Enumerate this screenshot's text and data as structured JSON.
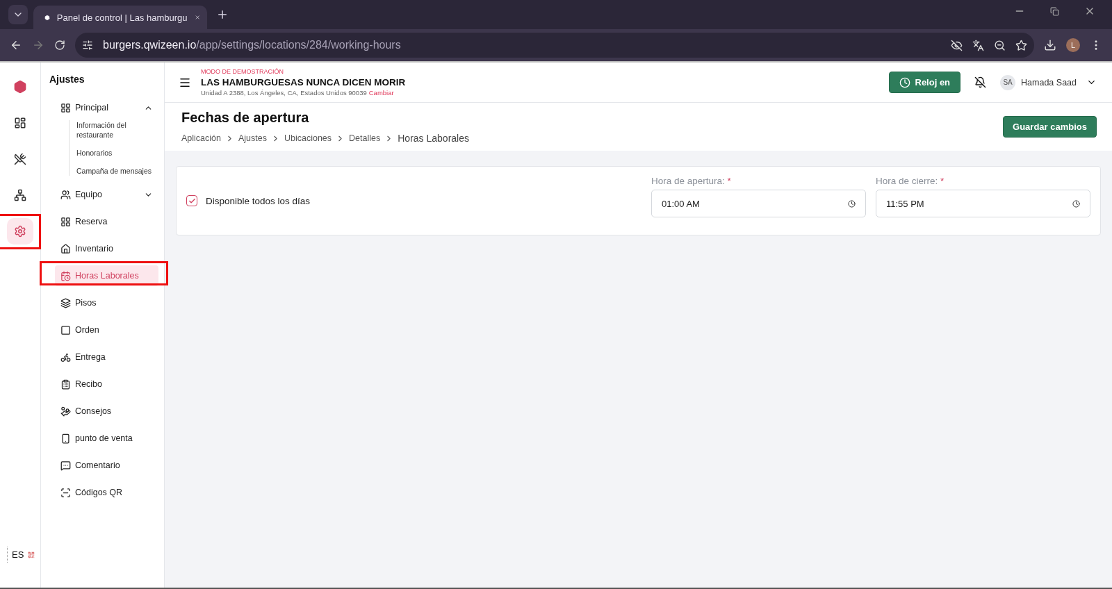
{
  "browser": {
    "tab_title": "Panel de control | Las hamburgu",
    "url_host": "burgers.qwizeen.io",
    "url_path": "/app/settings/locations/284/working-hours",
    "profile_initial": "L"
  },
  "rail": {
    "items": [
      {
        "selected": false
      },
      {
        "selected": false
      },
      {
        "selected": false
      },
      {
        "selected": true,
        "annotated": true
      }
    ]
  },
  "sidebar": {
    "title": "Ajustes",
    "items": [
      {
        "label": "Principal",
        "kind": "group",
        "expanded": true,
        "selected": false,
        "children": [
          {
            "label": "Información del restaurante"
          },
          {
            "label": "Honorarios"
          },
          {
            "label": "Campaña de mensajes"
          }
        ]
      },
      {
        "label": "Equipo",
        "kind": "group",
        "expanded": false,
        "selected": false
      },
      {
        "label": "Reserva",
        "kind": "link",
        "selected": false
      },
      {
        "label": "Inventario",
        "kind": "link",
        "selected": false
      },
      {
        "label": "Horas Laborales",
        "kind": "link",
        "selected": true,
        "annotated": true
      },
      {
        "label": "Pisos",
        "kind": "link",
        "selected": false
      },
      {
        "label": "Orden",
        "kind": "link",
        "selected": false
      },
      {
        "label": "Entrega",
        "kind": "link",
        "selected": false
      },
      {
        "label": "Recibo",
        "kind": "link",
        "selected": false
      },
      {
        "label": "Consejos",
        "kind": "link",
        "selected": false
      },
      {
        "label": "punto de venta",
        "kind": "link",
        "selected": false
      },
      {
        "label": "Comentario",
        "kind": "link",
        "selected": false
      },
      {
        "label": "Códigos QR",
        "kind": "link",
        "selected": false
      }
    ],
    "language": "ES"
  },
  "header": {
    "mode": "MODO DE DEMOSTRACIÓN",
    "restaurant": "LAS HAMBURGUESAS NUNCA DICEN MORIR",
    "address": "Unidad A 2388, Los Ángeles, CA, Estados Unidos 90039",
    "change_link": "Cambiar",
    "clock_button": "Reloj en",
    "user_initials": "SA",
    "user_name": "Hamada Saad"
  },
  "page": {
    "title": "Fechas de apertura",
    "breadcrumbs": [
      "Aplicación",
      "Ajustes",
      "Ubicaciones",
      "Detalles",
      "Horas Laborales"
    ],
    "save_button": "Guardar cambios"
  },
  "form": {
    "all_days": {
      "label": "Disponible todos los días",
      "checked": true
    },
    "fields": [
      {
        "label": "Hora de apertura:",
        "required_mark": "*",
        "value": "01:00 AM"
      },
      {
        "label": "Hora de cierre:",
        "required_mark": "*",
        "value": "11:55 PM"
      }
    ]
  }
}
